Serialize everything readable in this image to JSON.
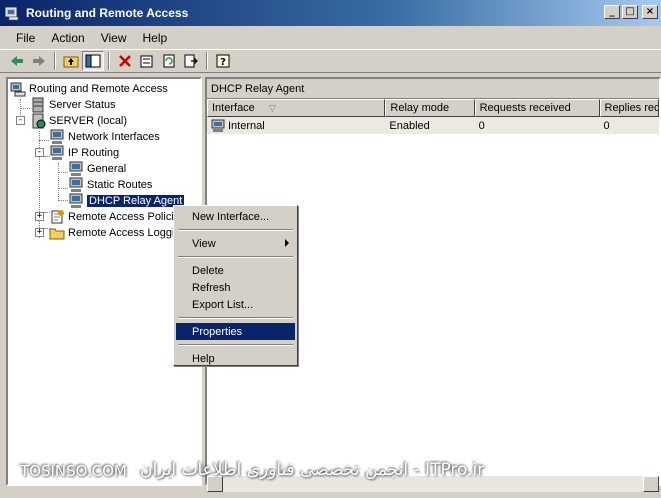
{
  "window": {
    "title": "Routing and Remote Access",
    "minimize_glyph": "_",
    "maximize_glyph": "□",
    "close_glyph": "×"
  },
  "menu": [
    "File",
    "Action",
    "View",
    "Help"
  ],
  "toolbar": {
    "icons": [
      "back-arrow-icon",
      "forward-arrow-icon",
      "up-folder-icon",
      "show-hide-tree-icon",
      "delete-icon",
      "properties-icon",
      "refresh-icon",
      "export-list-icon",
      "help-icon"
    ]
  },
  "tree": {
    "items": [
      {
        "label": "Routing and Remote Access"
      },
      {
        "label": "Server Status"
      },
      {
        "label": "SERVER (local)"
      },
      {
        "label": "Network Interfaces"
      },
      {
        "label": "IP Routing"
      },
      {
        "label": "General"
      },
      {
        "label": "Static Routes"
      },
      {
        "label": "DHCP Relay Agent"
      },
      {
        "label": "Remote Access Policie"
      },
      {
        "label": "Remote Access Loggi"
      }
    ]
  },
  "details": {
    "header": "DHCP Relay Agent",
    "columns": [
      "Interface",
      "Relay mode",
      "Requests received",
      "Replies rec"
    ],
    "rows": [
      {
        "interface": "Internal",
        "relay_mode": "Enabled",
        "requests": "0",
        "replies": "0"
      }
    ]
  },
  "context_menu": {
    "items": [
      "New Interface...",
      "View",
      "Delete",
      "Refresh",
      "Export List...",
      "Properties",
      "Help"
    ]
  },
  "watermark": {
    "left": "TOSINSO.COM",
    "right": "انجمن تخصصی فناوری اطلاعات ایران - ITPro.ir"
  },
  "colors": {
    "title_bar": "#0a246a",
    "selection": "#0a246a",
    "face": "#d4d0c8"
  }
}
